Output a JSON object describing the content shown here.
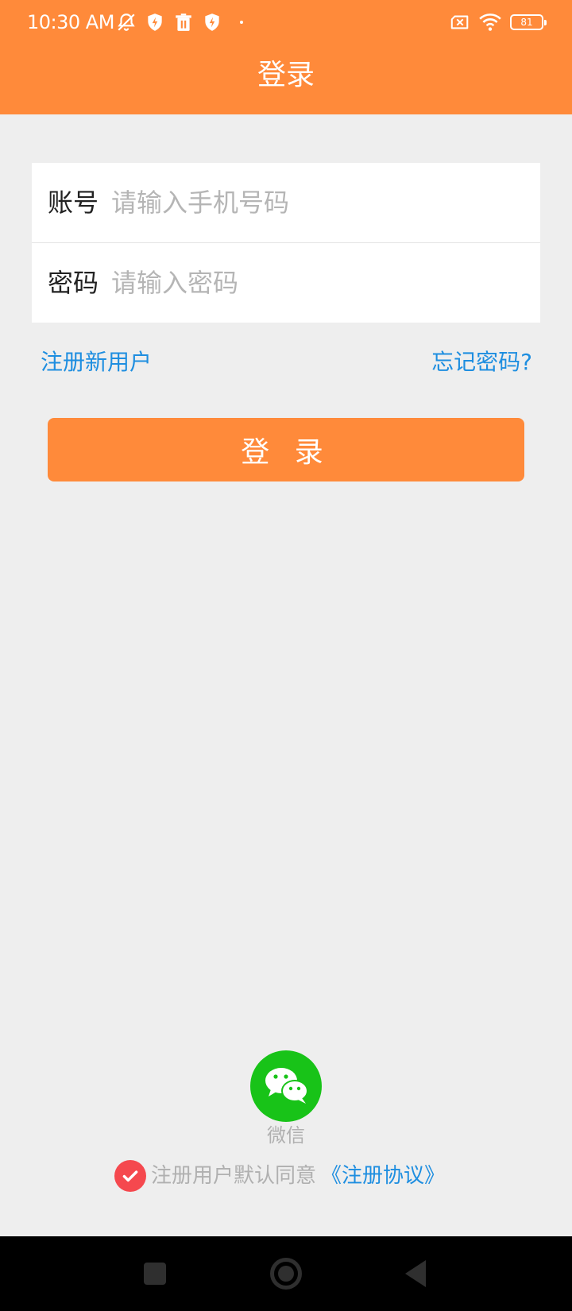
{
  "status_bar": {
    "time": "10:30 AM",
    "battery_level": "81",
    "left_icons": [
      "muted-bell-icon",
      "shield-icon",
      "trash-icon",
      "shield-bolt-icon"
    ],
    "right_icons": [
      "sim-x-icon",
      "wifi-icon",
      "battery-icon"
    ],
    "background_color": "#ff8a3a"
  },
  "app_bar": {
    "title": "登录",
    "background_color": "#ff8a3a"
  },
  "form": {
    "account": {
      "label": "账号",
      "value": "",
      "placeholder": "请输入手机号码"
    },
    "password": {
      "label": "密码",
      "value": "",
      "placeholder": "请输入密码"
    }
  },
  "links": {
    "register": "注册新用户",
    "forgot_password": "忘记密码?",
    "link_color": "#1e8ee0"
  },
  "login_button": {
    "label": "登 录",
    "color": "#ff8a3a"
  },
  "third_party": {
    "wechat_label": "微信",
    "wechat_icon": "wechat-icon",
    "wechat_color": "#18c318"
  },
  "agreement": {
    "checked": true,
    "text": "注册用户默认同意",
    "link": "《注册协议》",
    "check_color": "#f5484e"
  },
  "nav_bar": {
    "buttons": [
      "recent-apps-icon",
      "home-icon",
      "back-icon"
    ]
  }
}
